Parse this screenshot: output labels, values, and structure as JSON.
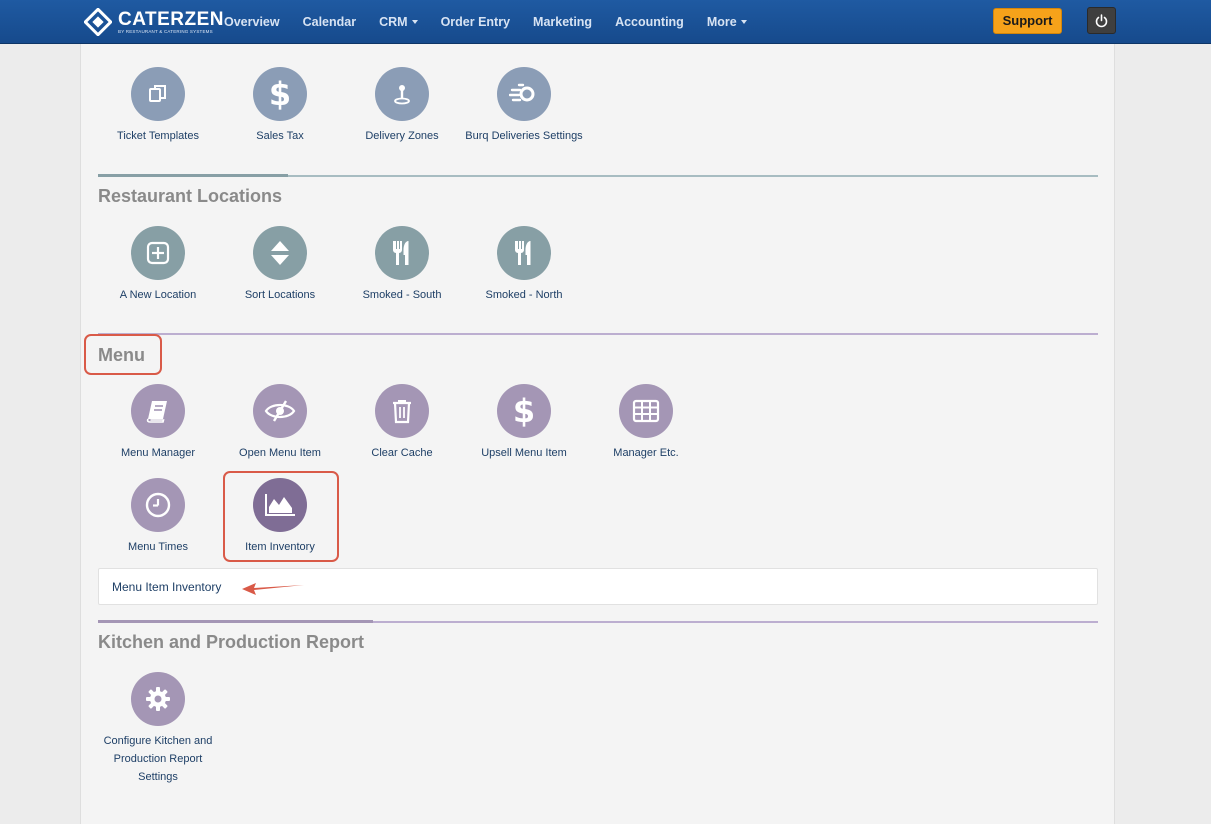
{
  "header": {
    "logo_name": "CATERZEN",
    "logo_sub": "BY RESTAURANT & CATERING SYSTEMS",
    "nav": [
      {
        "label": "Overview",
        "dropdown": false
      },
      {
        "label": "Calendar",
        "dropdown": false
      },
      {
        "label": "CRM",
        "dropdown": true
      },
      {
        "label": "Order Entry",
        "dropdown": false
      },
      {
        "label": "Marketing",
        "dropdown": false
      },
      {
        "label": "Accounting",
        "dropdown": false
      },
      {
        "label": "More",
        "dropdown": true
      }
    ],
    "support_label": "Support"
  },
  "top_tiles": [
    {
      "label": "Ticket Templates",
      "icon": "copy-icon"
    },
    {
      "label": "Sales Tax",
      "icon": "dollar-icon"
    },
    {
      "label": "Delivery Zones",
      "icon": "map-pin-icon"
    },
    {
      "label": "Burq Deliveries Settings",
      "icon": "fast-delivery-icon"
    }
  ],
  "sections": {
    "locations": {
      "title": "Restaurant Locations",
      "tiles": [
        {
          "label": "A New Location",
          "icon": "plus-square-icon"
        },
        {
          "label": "Sort Locations",
          "icon": "sort-icon"
        },
        {
          "label": "Smoked - South",
          "icon": "utensils-icon"
        },
        {
          "label": "Smoked - North",
          "icon": "utensils-icon"
        }
      ]
    },
    "menu": {
      "title": "Menu",
      "tiles": [
        {
          "label": "Menu Manager",
          "icon": "book-icon"
        },
        {
          "label": "Open Menu Item",
          "icon": "eye-slash-icon"
        },
        {
          "label": "Clear Cache",
          "icon": "trash-icon"
        },
        {
          "label": "Upsell Menu Item",
          "icon": "dollar-icon"
        },
        {
          "label": "Manager Etc.",
          "icon": "table-icon"
        },
        {
          "label": "Menu Times",
          "icon": "clock-icon"
        },
        {
          "label": "Item Inventory",
          "icon": "area-chart-icon"
        }
      ],
      "submenu_link": "Menu Item Inventory"
    },
    "kitchen": {
      "title": "Kitchen and Production Report",
      "tiles": [
        {
          "label": "Configure Kitchen and Production Report Settings",
          "icon": "gear-icon"
        }
      ]
    }
  },
  "colors": {
    "navbar": "#1f5aa2",
    "support": "#f6a21a",
    "highlight": "#d95a48",
    "tile_blue": "#8b9db6",
    "tile_teal": "#879fa5",
    "tile_purple": "#a496b5",
    "tile_purple_active": "#7f6d95"
  }
}
